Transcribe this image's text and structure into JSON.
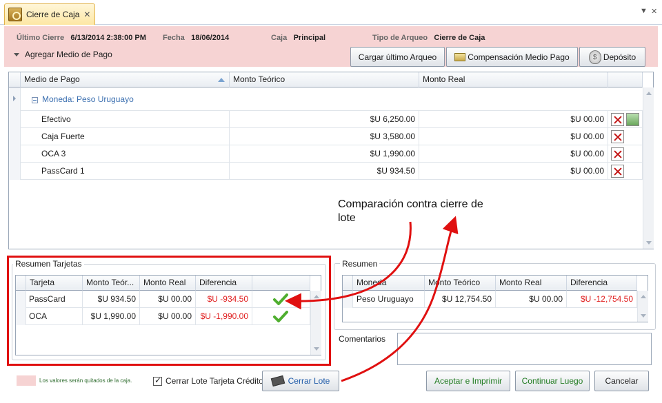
{
  "tab": {
    "title": "Cierre de Caja",
    "close": "✕"
  },
  "window_controls": {
    "menu": "▼",
    "close": "✕"
  },
  "header": {
    "ultimo_cierre_label": "Último Cierre",
    "ultimo_cierre_value": "6/13/2014 2:38:00 PM",
    "fecha_label": "Fecha",
    "fecha_value": "18/06/2014",
    "caja_label": "Caja",
    "caja_value": "Principal",
    "tipo_label": "Tipo de Arqueo",
    "tipo_value": "Cierre de Caja",
    "agregar_label": "Agregar Medio de Pago"
  },
  "toolbar": {
    "cargar_label": "Cargar último Arqueo",
    "compensacion_label": "Compensación Medio Pago",
    "deposito_label": "Depósito"
  },
  "main_grid": {
    "columns": [
      "Medio de Pago",
      "Monto Teórico",
      "Monto Real"
    ],
    "group_label": "Moneda: Peso Uruguayo",
    "rows": [
      {
        "medio": "Efectivo",
        "teorico": "$U 6,250.00",
        "real": "$U 00.00"
      },
      {
        "medio": "Caja Fuerte",
        "teorico": "$U 3,580.00",
        "real": "$U 00.00"
      },
      {
        "medio": "OCA 3",
        "teorico": "$U 1,990.00",
        "real": "$U 00.00"
      },
      {
        "medio": "PassCard 1",
        "teorico": "$U 934.50",
        "real": "$U 00.00"
      }
    ]
  },
  "annotation": {
    "text": "Comparación contra cierre de lote"
  },
  "resumen_tarjetas": {
    "title": "Resumen Tarjetas",
    "columns": [
      "Tarjeta",
      "Monto Teór...",
      "Monto Real",
      "Diferencia"
    ],
    "rows": [
      {
        "tarjeta": "PassCard",
        "teorico": "$U 934.50",
        "real": "$U 00.00",
        "diferencia": "$U -934.50"
      },
      {
        "tarjeta": "OCA",
        "teorico": "$U 1,990.00",
        "real": "$U 00.00",
        "diferencia": "$U -1,990.00"
      }
    ]
  },
  "resumen": {
    "title": "Resumen",
    "columns": [
      "Moneda",
      "Monto Teórico",
      "Monto Real",
      "Diferencia"
    ],
    "rows": [
      {
        "moneda": "Peso Uruguayo",
        "teorico": "$U 12,754.50",
        "real": "$U 00.00",
        "diferencia": "$U -12,754.50"
      }
    ]
  },
  "comentarios": {
    "label": "Comentarios",
    "value": ""
  },
  "footer": {
    "legend_text": "Los valores serán quitados de la caja.",
    "cerrar_lote_checkbox_label": "Cerrar Lote Tarjeta Crédito",
    "cerrar_lote_checked": true,
    "cerrar_lote_button": "Cerrar Lote",
    "aceptar_button": "Aceptar e Imprimir",
    "continuar_button": "Continuar Luego",
    "cancelar_button": "Cancelar"
  },
  "colors": {
    "header_bg": "#f6d3d3",
    "highlight_red": "#e01e1e",
    "group_text": "#3b6fb0",
    "green_text": "#1f7a1f"
  }
}
